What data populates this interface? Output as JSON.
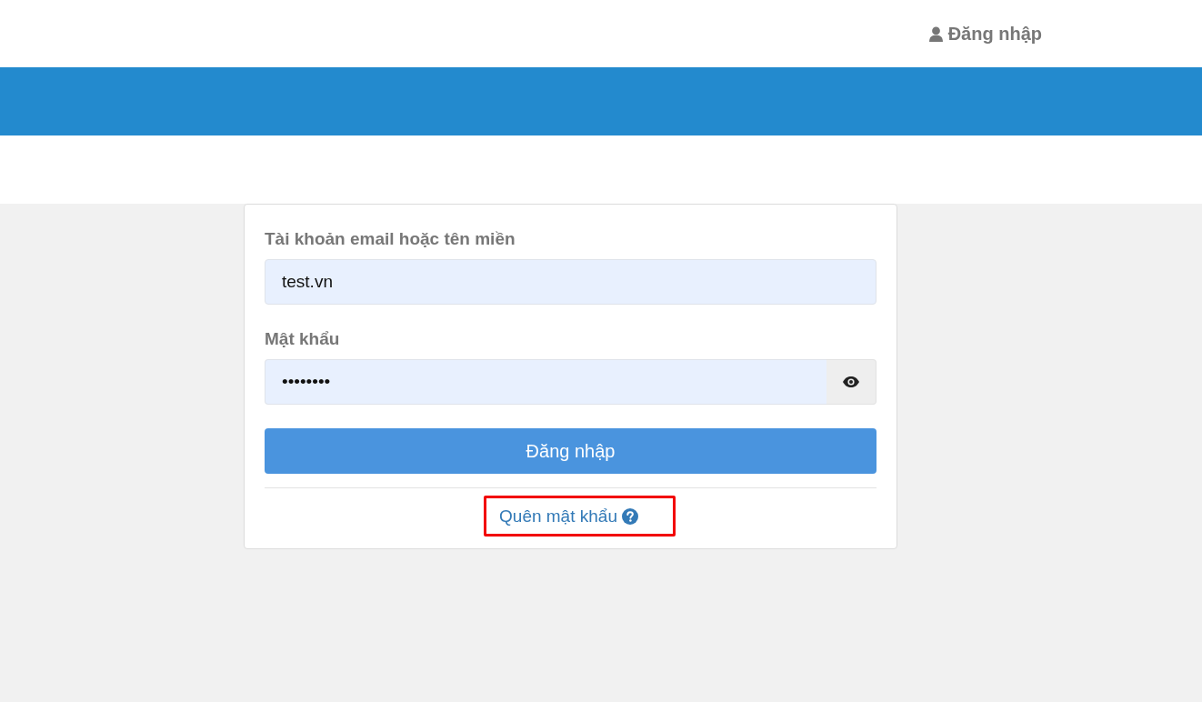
{
  "header": {
    "login_link": {
      "label": "Đăng nhập"
    }
  },
  "login_form": {
    "fields": [
      {
        "kind": "text",
        "label": "Tài khoản email hoặc tên miền",
        "value": "test.vn"
      },
      {
        "kind": "password",
        "label": "Mật khẩu",
        "value": "••••••••"
      }
    ],
    "submit_button": "Đăng nhập",
    "forgot_password": {
      "label": "Quên mật khẩu",
      "highlighted": true
    }
  }
}
